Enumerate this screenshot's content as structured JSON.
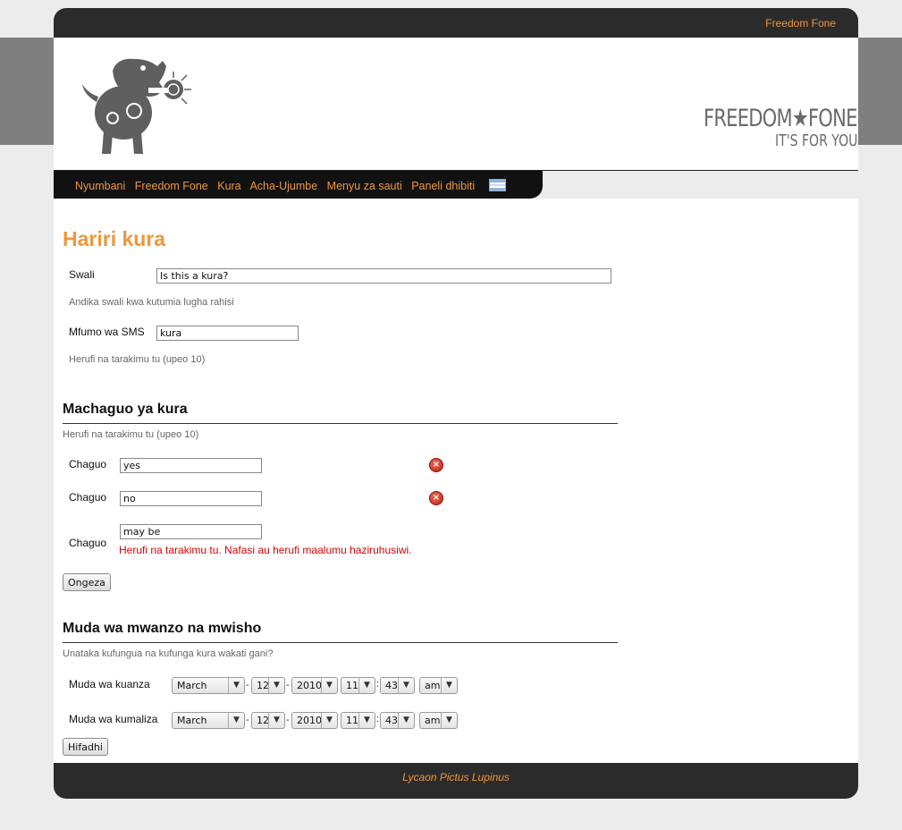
{
  "topbar": {
    "link": "Freedom Fone"
  },
  "brand": {
    "line1": "FREEDOM★FONE",
    "line2": "IT'S FOR YOU"
  },
  "nav": {
    "items": [
      "Nyumbani",
      "Freedom Fone",
      "Kura",
      "Acha-Ujumbe",
      "Menyu za sauti",
      "Paneli dhibiti"
    ]
  },
  "page": {
    "title": "Hariri kura"
  },
  "question": {
    "label": "Swali",
    "value": "Is this a kura?",
    "hint": "Andika swali kwa kutumia lugha rahisi"
  },
  "sms": {
    "label": "Mfumo wa SMS",
    "value": "kura",
    "hint": "Herufi na tarakimu tu (upeo 10)"
  },
  "choices": {
    "title": "Machaguo ya kura",
    "hint": "Herufi na tarakimu tu (upeo 10)",
    "items": [
      {
        "label": "Chaguo",
        "value": "yes"
      },
      {
        "label": "Chaguo",
        "value": "no"
      },
      {
        "label": "Chaguo",
        "value": "may be"
      }
    ],
    "error": "Herufi na tarakimu tu. Nafasi au herufi maalumu haziruhusiwi.",
    "add_button": "Ongeza"
  },
  "schedule": {
    "title": "Muda wa mwanzo na mwisho",
    "hint": "Unataka kufungua na kufunga kura wakati gani?",
    "start": {
      "label": "Muda wa kuanza",
      "month": "March",
      "day": "12",
      "year": "2010",
      "hour": "11",
      "minute": "43",
      "ampm": "am"
    },
    "end": {
      "label": "Muda wa kumaliza",
      "month": "March",
      "day": "12",
      "year": "2010",
      "hour": "11",
      "minute": "43",
      "ampm": "am"
    },
    "save_button": "Hifadhi"
  },
  "footer": {
    "text": "Lycaon Pictus Lupinus"
  },
  "colors": {
    "accent": "#f0963c",
    "dark": "#2b2b2b",
    "error": "#dd0000"
  }
}
